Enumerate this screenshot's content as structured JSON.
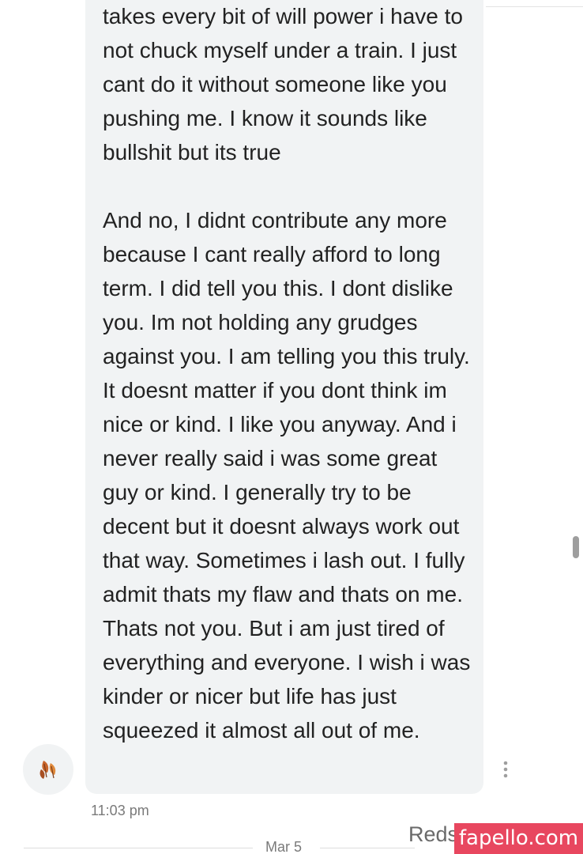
{
  "conversation": {
    "message": {
      "paragraphs": [
        "takes every bit of will power i have to not chuck myself under a train. I just cant do it without someone like you pushing me. I know it sounds like bullshit but its true",
        "And no, I didnt contribute any more because I cant really afford to long term. I did tell you this. I dont dislike you. Im not holding any grudges against you. I am telling you this truly. It doesnt matter if you dont think im nice or kind. I like you anyway. And i never really said i was some great guy or kind. I generally try to be decent but it doesnt always work out that way. Sometimes i lash out. I fully admit thats my flaw and thats on me. Thats not you. But i am just tired of everything and everyone. I wish i was kinder or nicer but life has just squeezed it almost all out of me."
      ],
      "timestamp": "11:03 pm",
      "avatar_icon": "autumn-leaves-icon",
      "options_icon": "more-vertical-icon"
    },
    "date_separator": "Mar 5",
    "next_message_sender": "Reds"
  },
  "watermark": {
    "text": "fapello.com",
    "color": "#e8475f"
  },
  "colors": {
    "bubble": "#f1f3f4",
    "text": "#222222",
    "meta": "#7a7a7a"
  }
}
